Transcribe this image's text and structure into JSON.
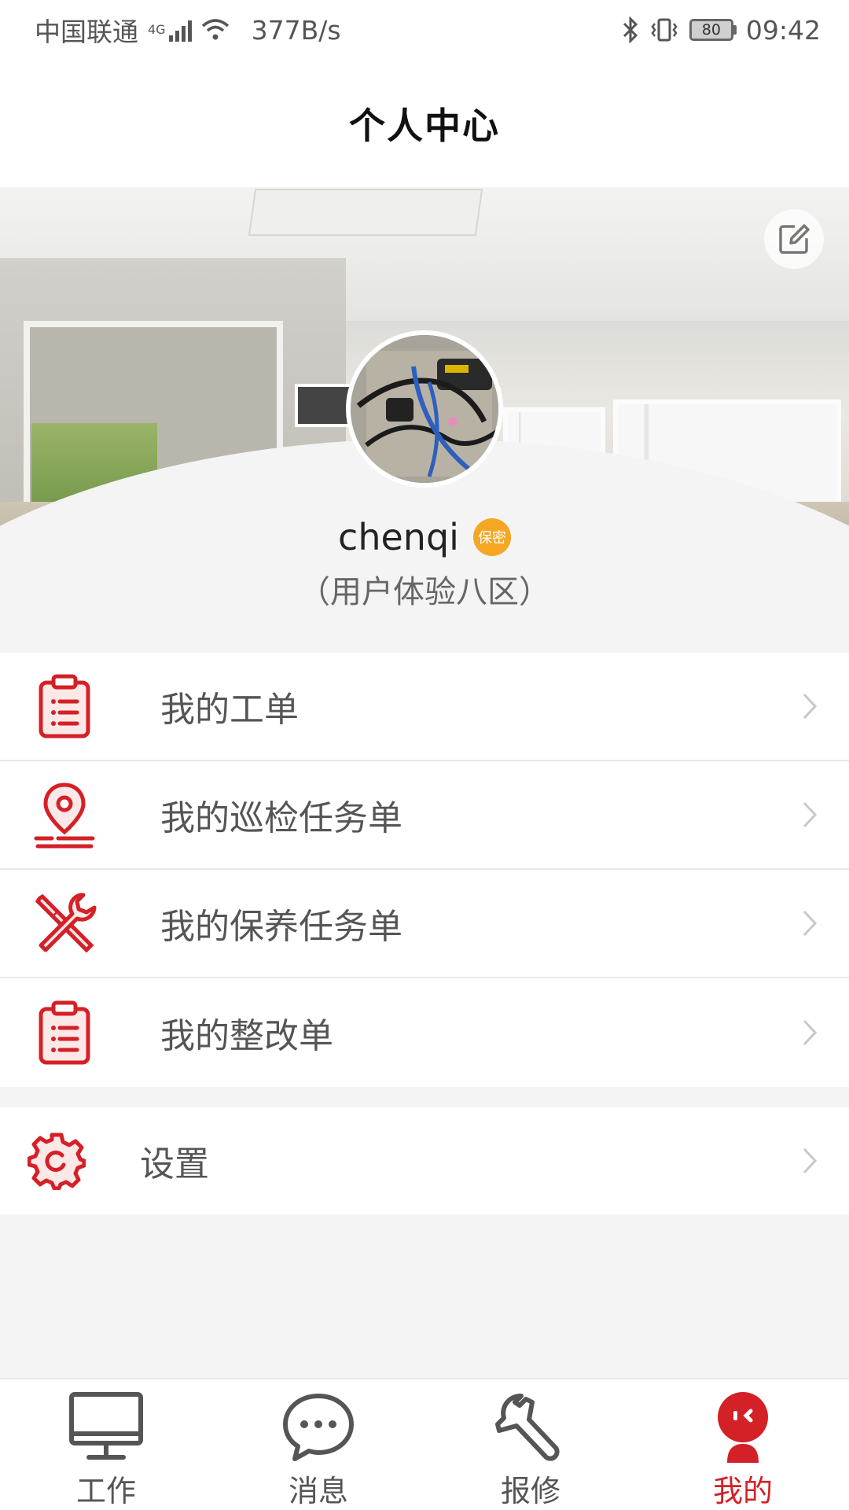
{
  "status_bar": {
    "carrier": "中国联通",
    "network": "4G",
    "speed": "377B/s",
    "battery": "80",
    "time": "09:42"
  },
  "header": {
    "title": "个人中心"
  },
  "profile": {
    "username": "chenqi",
    "badge": "保密",
    "org": "（用户体验八区）"
  },
  "menu": {
    "items": [
      {
        "label": "我的工单",
        "icon": "clipboard-icon"
      },
      {
        "label": "我的巡检任务单",
        "icon": "location-pin-icon"
      },
      {
        "label": "我的保养任务单",
        "icon": "tools-icon"
      },
      {
        "label": "我的整改单",
        "icon": "clipboard-icon"
      }
    ],
    "settings": {
      "label": "设置",
      "icon": "gear-icon"
    }
  },
  "tabbar": {
    "tabs": [
      {
        "label": "工作",
        "icon": "monitor-icon",
        "active": false
      },
      {
        "label": "消息",
        "icon": "chat-bubble-icon",
        "active": false
      },
      {
        "label": "报修",
        "icon": "wrench-icon",
        "active": false
      },
      {
        "label": "我的",
        "icon": "robot-avatar-icon",
        "active": true
      }
    ]
  },
  "colors": {
    "accent": "#d42027",
    "badge": "#f5a623",
    "background": "#f4f4f4"
  }
}
